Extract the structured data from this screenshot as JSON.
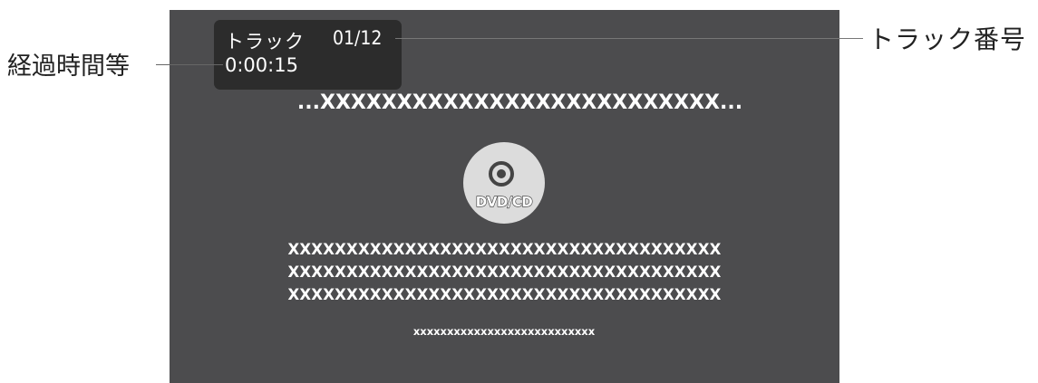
{
  "overlay": {
    "track_label": "トラック",
    "track_number": "01/12",
    "elapsed_time": "0:00:15"
  },
  "main": {
    "title": "...XXXXXXXXXXXXXXXXXXXXXXXXXX...",
    "disc_label": "DVD/CD",
    "description_lines": [
      "XXXXXXXXXXXXXXXXXXXXXXXXXXXXXXXXXXXXX",
      "XXXXXXXXXXXXXXXXXXXXXXXXXXXXXXXXXXXXX",
      "XXXXXXXXXXXXXXXXXXXXXXXXXXXXXXXXXXXXX"
    ],
    "small_text": "xxxxxxxxxxxxxxxxxxxxxxxxxxx"
  },
  "callouts": {
    "elapsed_callout": "経過時間等",
    "track_number_callout": "トラック番号"
  },
  "icons": {
    "disc": "disc-icon"
  },
  "colors": {
    "screen_bg": "#4c4c4e",
    "overlay_bg": "#2c2c2c",
    "text": "#ffffff"
  }
}
